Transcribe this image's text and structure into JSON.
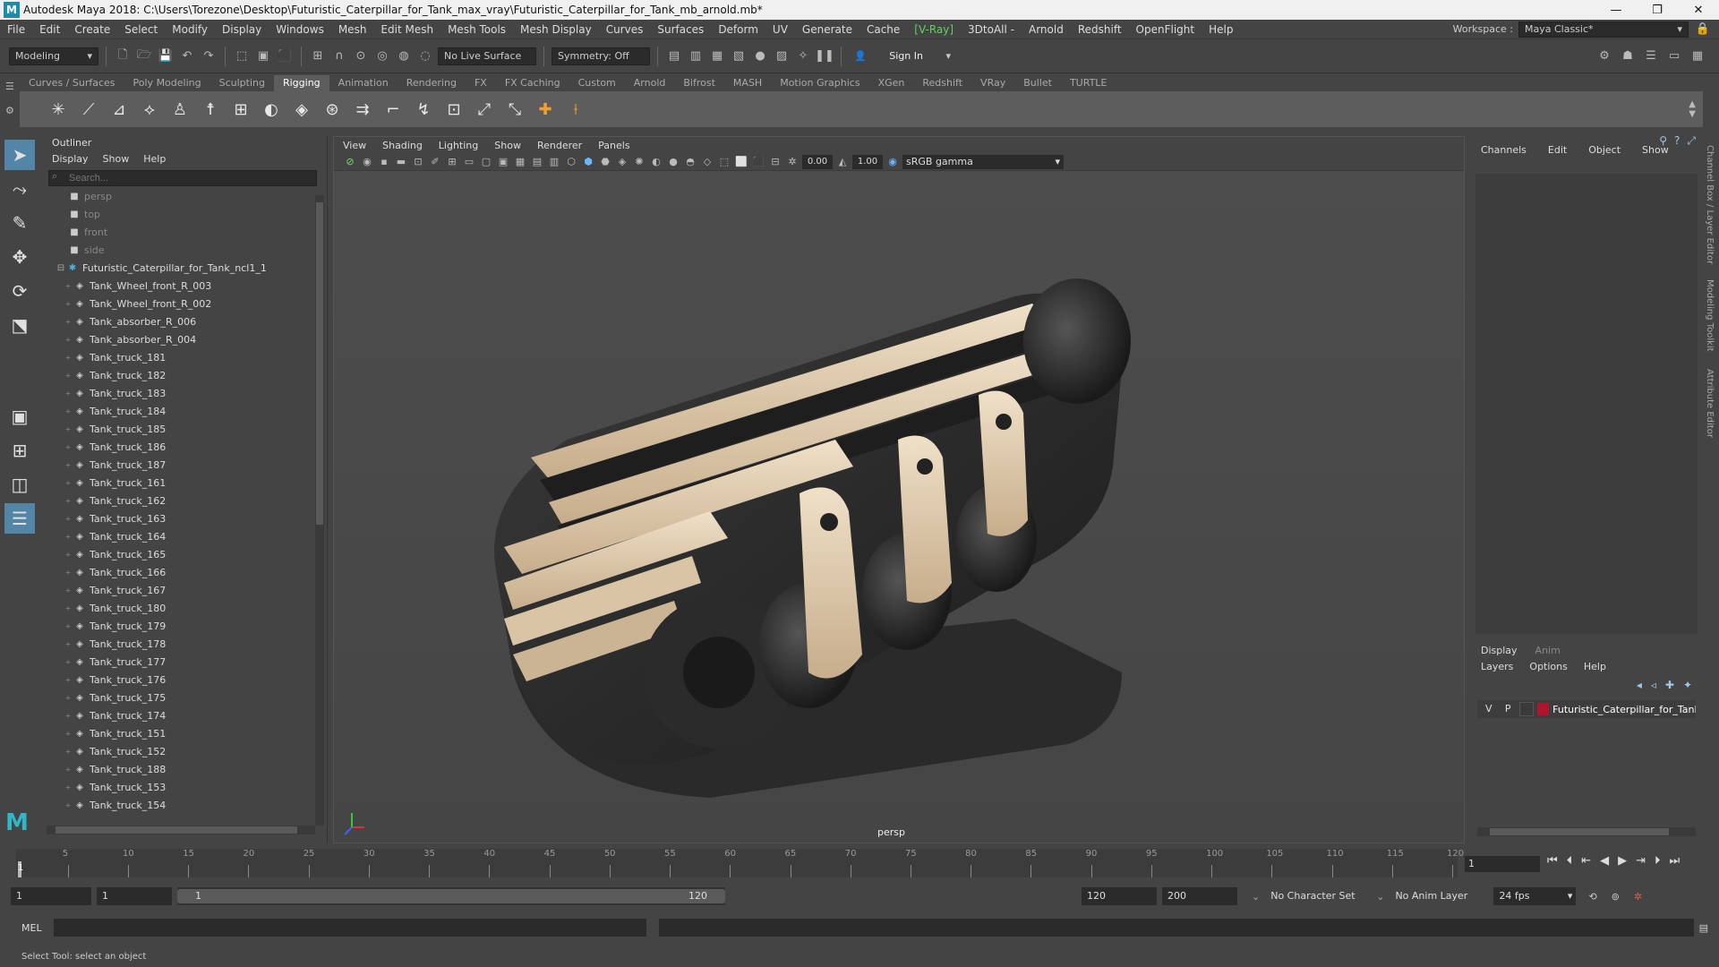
{
  "window": {
    "title": "Autodesk Maya 2018: C:\\Users\\Torezone\\Desktop\\Futuristic_Caterpillar_for_Tank_max_vray\\Futuristic_Caterpillar_for_Tank_mb_arnold.mb*",
    "logo": "M"
  },
  "menubar": {
    "items": [
      "File",
      "Edit",
      "Create",
      "Select",
      "Modify",
      "Display",
      "Windows",
      "Mesh",
      "Edit Mesh",
      "Mesh Tools",
      "Mesh Display",
      "Curves",
      "Surfaces",
      "Deform",
      "UV",
      "Generate",
      "Cache",
      "[V-Ray]",
      "3DtoAll -",
      "Arnold",
      "Redshift",
      "OpenFlight",
      "Help"
    ],
    "workspace_label": "Workspace :",
    "workspace_value": "Maya Classic*"
  },
  "statusline": {
    "mode": "Modeling",
    "live_surface": "No Live Surface",
    "symmetry": "Symmetry: Off",
    "sign_in": "Sign In"
  },
  "shelf": {
    "tabs": [
      "Curves / Surfaces",
      "Poly Modeling",
      "Sculpting",
      "Rigging",
      "Animation",
      "Rendering",
      "FX",
      "FX Caching",
      "Custom",
      "Arnold",
      "Bifrost",
      "MASH",
      "Motion Graphics",
      "XGen",
      "Redshift",
      "VRay",
      "Bullet",
      "TURTLE"
    ],
    "active_tab": "Rigging"
  },
  "outliner": {
    "title": "Outliner",
    "menu": [
      "Display",
      "Show",
      "Help"
    ],
    "search_placeholder": "Search...",
    "cameras": [
      "persp",
      "top",
      "front",
      "side"
    ],
    "root": "Futuristic_Caterpillar_for_Tank_ncl1_1",
    "children": [
      "Tank_Wheel_front_R_003",
      "Tank_Wheel_front_R_002",
      "Tank_absorber_R_006",
      "Tank_absorber_R_004",
      "Tank_truck_181",
      "Tank_truck_182",
      "Tank_truck_183",
      "Tank_truck_184",
      "Tank_truck_185",
      "Tank_truck_186",
      "Tank_truck_187",
      "Tank_truck_161",
      "Tank_truck_162",
      "Tank_truck_163",
      "Tank_truck_164",
      "Tank_truck_165",
      "Tank_truck_166",
      "Tank_truck_167",
      "Tank_truck_180",
      "Tank_truck_179",
      "Tank_truck_178",
      "Tank_truck_177",
      "Tank_truck_176",
      "Tank_truck_175",
      "Tank_truck_174",
      "Tank_truck_151",
      "Tank_truck_152",
      "Tank_truck_188",
      "Tank_truck_153",
      "Tank_truck_154"
    ]
  },
  "viewport": {
    "menu": [
      "View",
      "Shading",
      "Lighting",
      "Show",
      "Renderer",
      "Panels"
    ],
    "near_value": "0.00",
    "far_value": "1.00",
    "color_space": "sRGB gamma",
    "camera_label": "persp"
  },
  "channelbox": {
    "menu": [
      "Channels",
      "Edit",
      "Object",
      "Show"
    ],
    "layer_tabs": [
      "Display",
      "Anim"
    ],
    "layer_menu": [
      "Layers",
      "Options",
      "Help"
    ],
    "layer": {
      "v": "V",
      "p": "P",
      "name": "Futuristic_Caterpillar_for_Tank",
      "color": "#b0142c"
    },
    "side_tabs": [
      "Channel Box / Layer Editor",
      "Modeling Toolkit",
      "Attribute Editor"
    ]
  },
  "timeslider": {
    "ticks": [
      1,
      5,
      10,
      15,
      20,
      25,
      30,
      35,
      40,
      45,
      50,
      55,
      60,
      65,
      70,
      75,
      80,
      85,
      90,
      95,
      100,
      105,
      110,
      115,
      120
    ],
    "current_frame": "1",
    "range_min": 1,
    "range_max": 120
  },
  "rangebar": {
    "start": "1",
    "playback_start": "1",
    "slider_start": "1",
    "slider_end": "120",
    "playback_end": "120",
    "end": "200",
    "character_set": "No Character Set",
    "anim_layer": "No Anim Layer",
    "fps": "24 fps"
  },
  "cmdline": {
    "label": "MEL"
  },
  "helpline": {
    "text": "Select Tool: select an object"
  }
}
